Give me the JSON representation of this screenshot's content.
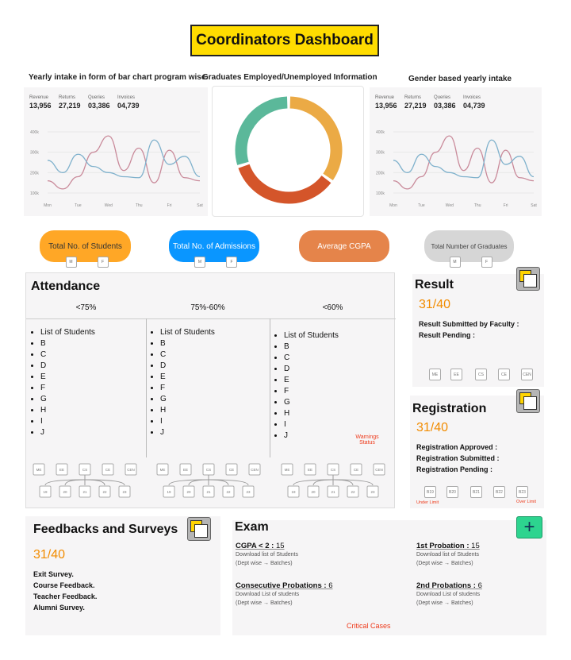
{
  "title": "Coordinators Dashboard",
  "captions": {
    "left": "Yearly intake in form of bar chart program wise.",
    "center": "Graduates Employed/Unemployed Information",
    "right": "Gender based yearly intake"
  },
  "chart_data": [
    {
      "type": "line",
      "stats": [
        {
          "label": "Revenue",
          "value": "13,956"
        },
        {
          "label": "Returns",
          "value": "27,219"
        },
        {
          "label": "Queries",
          "value": "03,386"
        },
        {
          "label": "Invoices",
          "value": "04,739"
        }
      ],
      "categories": [
        "Mon",
        "Tue",
        "Wed",
        "Thu",
        "Fri",
        "Sat"
      ],
      "yticks": [
        "400k",
        "300k",
        "200k",
        "100k"
      ],
      "ylim": [
        100,
        400
      ],
      "series": [
        {
          "color": "#c98a9a",
          "values": [
            160,
            120,
            180,
            300,
            380,
            210,
            320,
            150,
            310,
            175,
            160
          ]
        },
        {
          "color": "#7fb1cc",
          "values": [
            260,
            200,
            290,
            230,
            200,
            180,
            175,
            360,
            240,
            280,
            180
          ]
        }
      ]
    },
    {
      "type": "pie",
      "donut": true,
      "values": [
        35,
        35,
        30
      ],
      "colors": [
        "#ebaa45",
        "#d4552a",
        "#5bb89a"
      ]
    },
    {
      "type": "line",
      "stats": [
        {
          "label": "Revenue",
          "value": "13,956"
        },
        {
          "label": "Returns",
          "value": "27,219"
        },
        {
          "label": "Queries",
          "value": "03,386"
        },
        {
          "label": "Invoices",
          "value": "04,739"
        }
      ],
      "categories": [
        "Mon",
        "Tue",
        "Wed",
        "Thu",
        "Fri",
        "Sat"
      ],
      "yticks": [
        "400k",
        "300k",
        "200k",
        "100k"
      ],
      "ylim": [
        100,
        400
      ],
      "series": [
        {
          "color": "#c98a9a",
          "values": [
            160,
            120,
            180,
            300,
            380,
            210,
            320,
            150,
            310,
            175,
            160
          ]
        },
        {
          "color": "#7fb1cc",
          "values": [
            260,
            200,
            290,
            230,
            200,
            180,
            175,
            360,
            240,
            280,
            180
          ]
        }
      ]
    }
  ],
  "pills": [
    {
      "label": "Total No. of Students",
      "color": "#ffa726"
    },
    {
      "label": "Total No. of Admissions",
      "color": "#0a96ff"
    },
    {
      "label": "Average CGPA",
      "color": "#e5844a"
    },
    {
      "label": "Total Number of Graduates",
      "color": "#d6d6d6"
    }
  ],
  "mf": [
    "M",
    "F"
  ],
  "attendance": {
    "title": "Attendance",
    "columns": [
      {
        "header": "<75%",
        "items": [
          "List of Students",
          "B",
          "C",
          "D",
          "E",
          "F",
          "G",
          "H",
          "I",
          "J"
        ]
      },
      {
        "header": "75%-60%",
        "items": [
          "List of Students",
          "B",
          "C",
          "D",
          "E",
          "F",
          "G",
          "H",
          "I",
          "J"
        ]
      },
      {
        "header": "<60%",
        "items": [
          "List of Students",
          "B",
          "C",
          "D",
          "E",
          "F",
          "G",
          "H",
          "I",
          "J"
        ]
      }
    ],
    "warning": "Warnings Status",
    "depts": [
      "ME",
      "EE",
      "CS",
      "CE",
      "CEN"
    ],
    "batches": [
      "19",
      "20",
      "21",
      "22",
      "23"
    ]
  },
  "result": {
    "title": "Result",
    "count": "31/40",
    "lines": [
      "Result Submitted by Faculty :",
      "Result Pending :"
    ],
    "depts": [
      "ME",
      "EE",
      "CS",
      "CE",
      "CEN"
    ]
  },
  "registration": {
    "title": "Registration",
    "count": "31/40",
    "lines": [
      "Registration Approved :",
      "Registration Submitted :",
      "Registration Pending :"
    ],
    "batches": [
      "B19",
      "B20",
      "B21",
      "B22",
      "B23"
    ],
    "under": "Under Limit",
    "over": "Over Limit"
  },
  "feedback": {
    "title": "Feedbacks and Surveys",
    "count": "31/40",
    "items": [
      "Exit Survey.",
      "Course Feedback.",
      "Teacher Feedback.",
      "Alumni Survey."
    ]
  },
  "exam": {
    "title": "Exam",
    "plus": "+",
    "items": [
      {
        "label": "CGPA < 2 :",
        "value": " 15",
        "l1": "Download list of Students",
        "l2": "(Dept wise → Batches)"
      },
      {
        "label": "1st  Probation :",
        "value": " 15",
        "l1": "Download list of Students",
        "l2": "(Dept wise → Batches)"
      },
      {
        "label": "Consecutive Probations :",
        "value": " 6",
        "l1": "Download List of students",
        "l2": "(Dept wise → Batches)"
      },
      {
        "label": "2nd Probations :",
        "value": " 6",
        "l1": "Download List of students",
        "l2": "(Dept wise → Batches)"
      }
    ],
    "critical": "Critical Cases"
  }
}
